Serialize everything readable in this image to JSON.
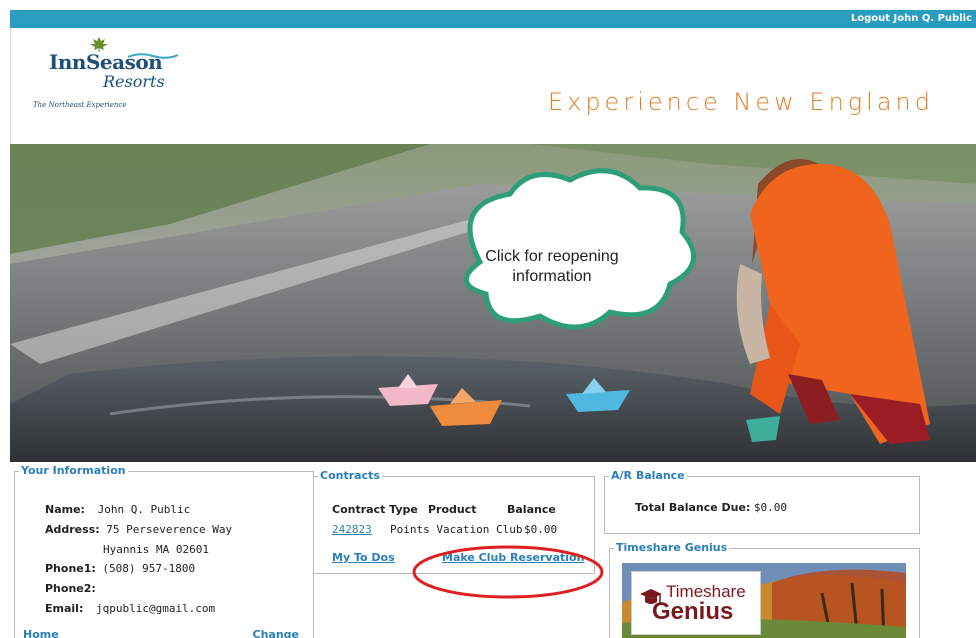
{
  "topbar": {
    "logout_label": "Logout John Q. Public",
    "color": "#2a9cbf"
  },
  "brand": {
    "name_line1": "InnSeason",
    "name_line2": "Resorts",
    "tagline": "The Northeast Experience",
    "slogan": "Experience New England",
    "slogan_color": "#e07b22"
  },
  "hero": {
    "bubble_text": "Click for reopening information"
  },
  "your_information": {
    "legend": "Your Information",
    "name_label": "Name:",
    "name_value": "John Q. Public",
    "address_label": "Address:",
    "address_line1": "75 Perseverence Way",
    "address_line2": "Hyannis MA  02601",
    "phone1_label": "Phone1:",
    "phone1_value": "(508) 957-1800",
    "phone2_label": "Phone2:",
    "phone2_value": "",
    "email_label": "Email:",
    "email_value": "jqpublic@gmail.com",
    "home_link": "Home",
    "change_link": "Change"
  },
  "contracts": {
    "legend": "Contracts",
    "headers": [
      "Contract Type",
      "Product",
      "Balance"
    ],
    "rows": [
      {
        "contract": "242823",
        "product": "Points Vacation Club",
        "balance": "$0.00"
      }
    ],
    "my_todos_link": "My To Dos",
    "reservation_link": "Make Club Reservation",
    "highlight_color": "#e02020"
  },
  "ar_balance": {
    "legend": "A/R Balance",
    "total_label": "Total Balance Due:",
    "total_value": "$0.00"
  },
  "timeshare_genius": {
    "legend": "Timeshare Genius",
    "logo_line1": "Timeshare",
    "logo_line2": "Genius"
  },
  "accent_link_color": "#2a7fb8"
}
